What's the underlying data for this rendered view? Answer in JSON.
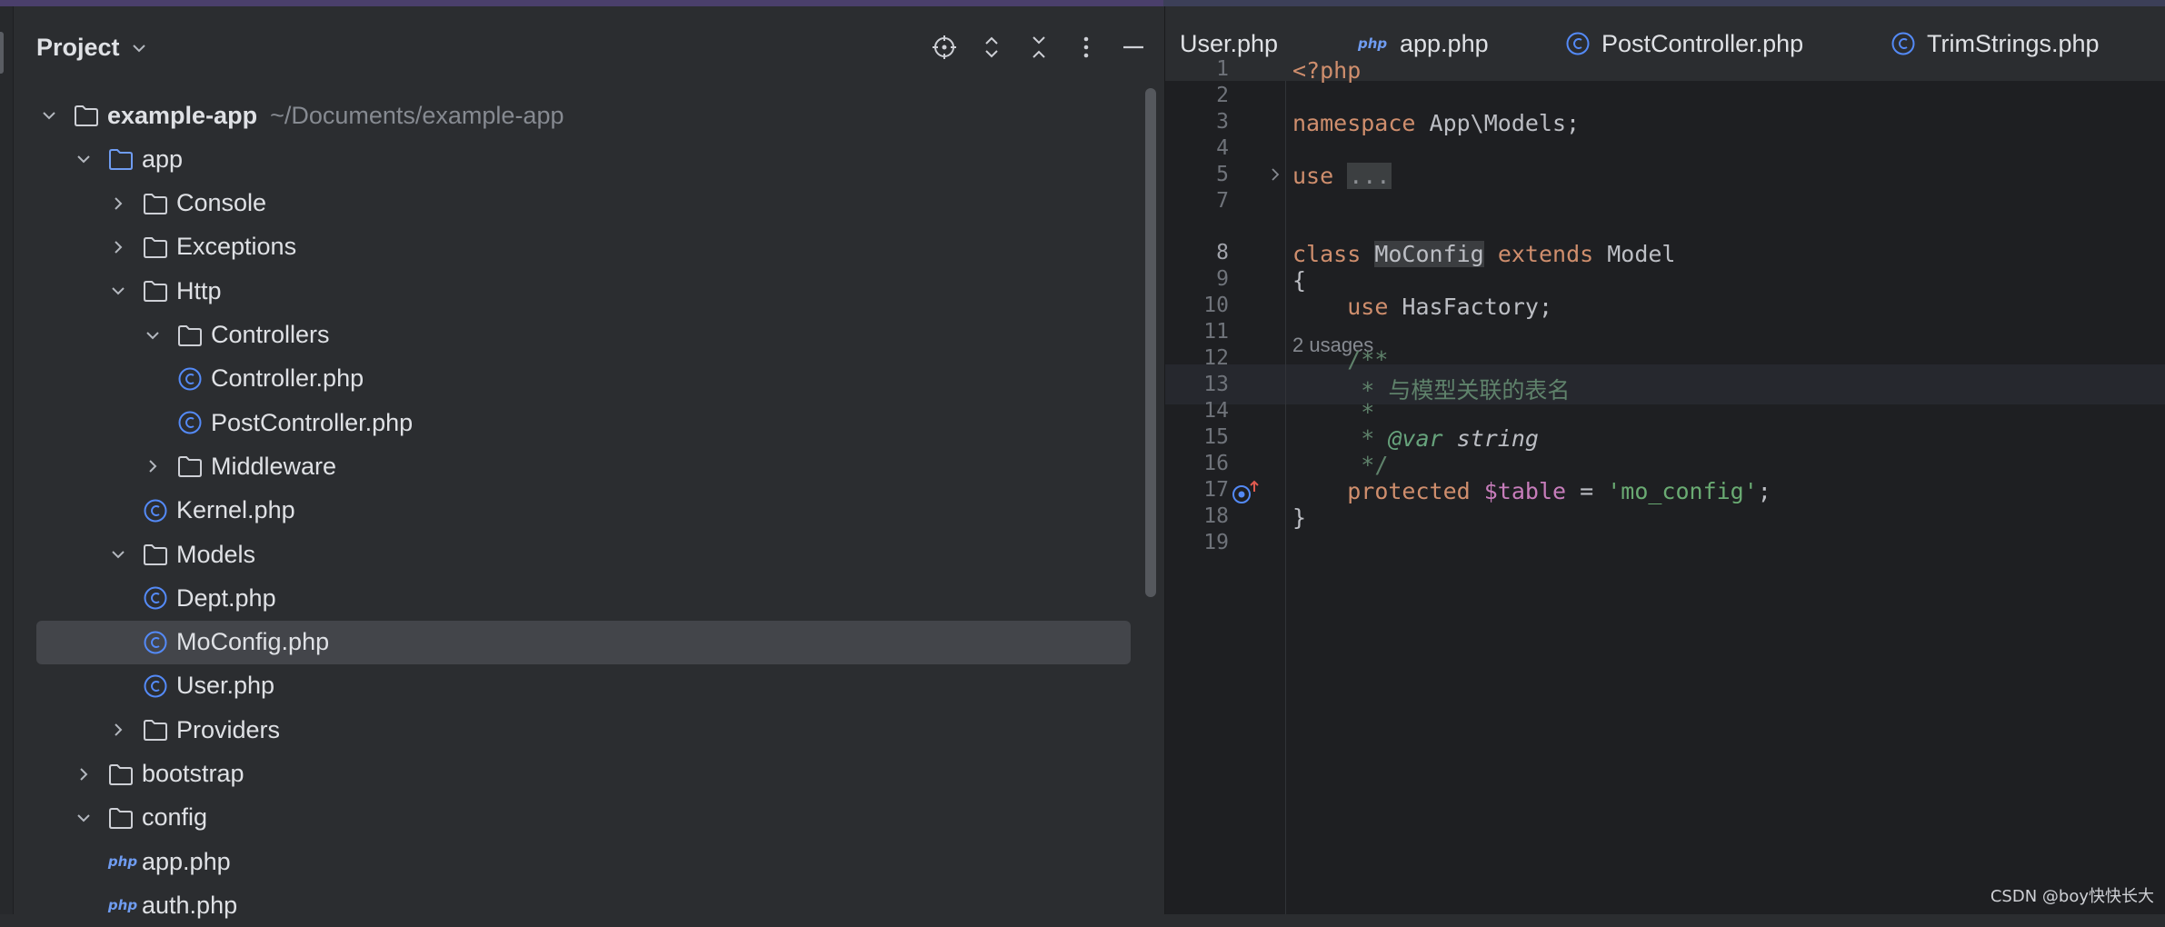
{
  "panel": {
    "title": "Project"
  },
  "tree": [
    {
      "label": "example-app",
      "path": "~/Documents/example-app",
      "depth": 0,
      "expanded": true,
      "type": "folder",
      "bold": true
    },
    {
      "label": "app",
      "depth": 1,
      "expanded": true,
      "type": "folder-blue"
    },
    {
      "label": "Console",
      "depth": 2,
      "expanded": false,
      "type": "folder"
    },
    {
      "label": "Exceptions",
      "depth": 2,
      "expanded": false,
      "type": "folder"
    },
    {
      "label": "Http",
      "depth": 2,
      "expanded": true,
      "type": "folder"
    },
    {
      "label": "Controllers",
      "depth": 3,
      "expanded": true,
      "type": "folder"
    },
    {
      "label": "Controller.php",
      "depth": 4,
      "type": "class"
    },
    {
      "label": "PostController.php",
      "depth": 4,
      "type": "class"
    },
    {
      "label": "Middleware",
      "depth": 3,
      "expanded": false,
      "type": "folder"
    },
    {
      "label": "Kernel.php",
      "depth": 3,
      "type": "class"
    },
    {
      "label": "Models",
      "depth": 2,
      "expanded": true,
      "type": "folder"
    },
    {
      "label": "Dept.php",
      "depth": 3,
      "type": "class"
    },
    {
      "label": "MoConfig.php",
      "depth": 3,
      "type": "class",
      "selected": true
    },
    {
      "label": "User.php",
      "depth": 3,
      "type": "class"
    },
    {
      "label": "Providers",
      "depth": 2,
      "expanded": false,
      "type": "folder"
    },
    {
      "label": "bootstrap",
      "depth": 1,
      "expanded": false,
      "type": "folder"
    },
    {
      "label": "config",
      "depth": 1,
      "expanded": true,
      "type": "folder"
    },
    {
      "label": "app.php",
      "depth": 2,
      "type": "php"
    },
    {
      "label": "auth.php",
      "depth": 2,
      "type": "php"
    }
  ],
  "tabs": [
    {
      "label": "User.php",
      "icon": "none"
    },
    {
      "label": "app.php",
      "icon": "php-icon",
      "badge": "php"
    },
    {
      "label": "PostController.php",
      "icon": "class-icon"
    },
    {
      "label": "TrimStrings.php",
      "icon": "class-icon"
    }
  ],
  "editor": {
    "line_numbers": [
      "1",
      "2",
      "3",
      "4",
      "5",
      "7",
      "8",
      "9",
      "10",
      "11",
      "12",
      "13",
      "14",
      "15",
      "16",
      "17",
      "18",
      "19"
    ],
    "current_line": "8",
    "usages_hint": "2 usages",
    "lines": {
      "l1": "<?php",
      "l3_kw": "namespace",
      "l3_rest": " App\\Models;",
      "l5_kw": "use",
      "l5_fold": "...",
      "l8_kw1": "class",
      "l8_name": "MoConfig",
      "l8_kw2": "extends",
      "l8_rest": " Model",
      "l9": "{",
      "l10_kw": "use",
      "l10_rest": " HasFactory;",
      "l12": "/**",
      "l13": " * 与模型关联的表名",
      "l14": " *",
      "l15_star": " * ",
      "l15_tag": "@var",
      "l15_type": " string",
      "l16": " */",
      "l17_kw": "protected",
      "l17_var": "$table",
      "l17_eq": " = ",
      "l17_str": "'mo_config'",
      "l17_semi": ";",
      "l18": "}"
    }
  },
  "watermark": "CSDN @boy快快长大",
  "colors": {
    "background": "#2b2d30",
    "editor_bg": "#1e1f22",
    "keyword": "#cf8e6d",
    "string": "#6aab73",
    "comment": "#5f826b",
    "variable": "#c77dbb",
    "class_icon": "#548af7"
  }
}
